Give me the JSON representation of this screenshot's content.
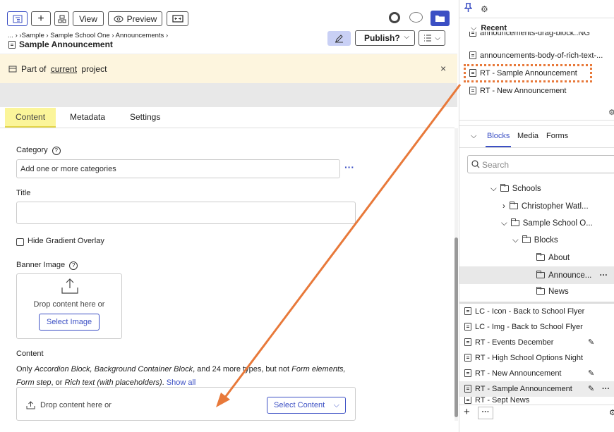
{
  "toolbar": {
    "view_label": "View",
    "preview_label": "Preview",
    "publish_label": "Publish?"
  },
  "breadcrumb": {
    "ellipsis": "...",
    "items": [
      "Sample",
      "Sample School One",
      "Announcements"
    ],
    "page_title": "Sample Announcement"
  },
  "banner": {
    "prefix": "Part of",
    "link": "current",
    "suffix": "project"
  },
  "tabs": [
    "Content",
    "Metadata",
    "Settings"
  ],
  "form": {
    "category_label": "Category",
    "category_placeholder": "Add one or more categories",
    "title_label": "Title",
    "title_value": "",
    "hide_overlay_label": "Hide Gradient Overlay",
    "banner_label": "Banner Image",
    "drop_text": "Drop content here or",
    "select_image": "Select Image",
    "content_label": "Content",
    "content_desc_1": "Only",
    "content_types_1": "Accordion Block, Background Container Block",
    "content_desc_2": ", and 24 more types, but not",
    "content_types_2": "Form elements,",
    "content_types_3": "Form step",
    "content_desc_3": ", or",
    "content_types_4": "Rich text (with placeholders)",
    "content_desc_4": ".",
    "show_all": "Show all",
    "drop_content": "Drop content here or",
    "select_content": "Select Content"
  },
  "sidebar": {
    "recent_label": "Recent",
    "recent_items": [
      "announcements-drag-block..NG",
      "announcements-body-of-rich-text-...",
      "RT - Sample Announcement",
      "RT - New Announcement"
    ],
    "tabs": [
      "Blocks",
      "Media",
      "Forms"
    ],
    "search_placeholder": "Search",
    "tree": [
      {
        "label": "Schools",
        "level": 0,
        "expanded": true
      },
      {
        "label": "Christopher Watl...",
        "level": 1,
        "expanded": false
      },
      {
        "label": "Sample School O...",
        "level": 1,
        "expanded": true
      },
      {
        "label": "Blocks",
        "level": 2,
        "expanded": true
      },
      {
        "label": "About",
        "level": 3
      },
      {
        "label": "Announce...",
        "level": 3,
        "selected": true
      },
      {
        "label": "News",
        "level": 3
      }
    ],
    "list": [
      "LC - Icon - Back to School Flyer",
      "LC - Img - Back to School Flyer",
      "RT - Events December",
      "RT - High School Options Night",
      "RT - New Announcement",
      "RT - Sample Announcement",
      "RT - Sept News"
    ]
  },
  "colors": {
    "accent": "#3b4fc4",
    "banner_bg": "#fdf5de",
    "tab_highlight": "#fbf59a",
    "annotation": "#e8793a",
    "publish_pencil_bg": "#c9d0f5"
  }
}
